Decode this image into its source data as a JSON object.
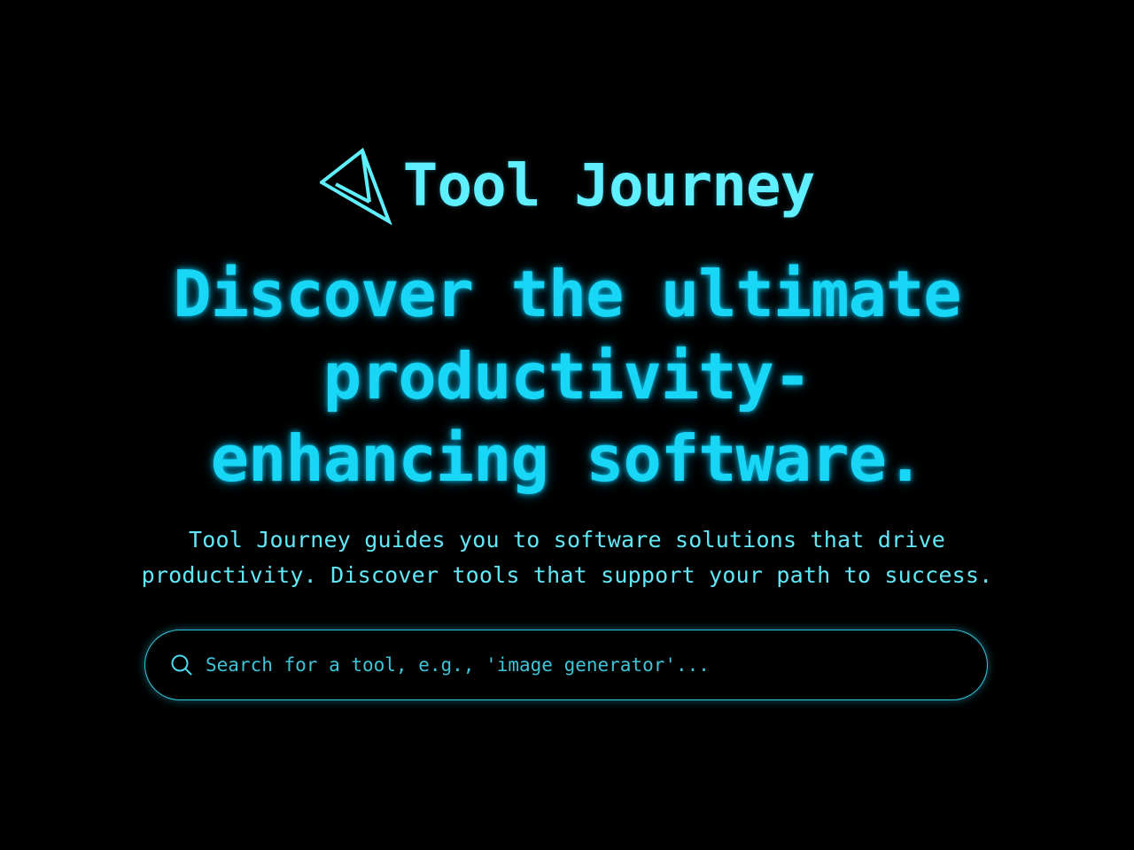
{
  "brand": {
    "name": "Tool Journey",
    "logo_icon": "paper-plane-arrow-logo",
    "color": "#5ff0ff"
  },
  "hero": {
    "headline_lines": [
      "Discover the ultimate",
      "productivity-",
      "enhancing software."
    ],
    "subtitle_lines": [
      "Tool Journey guides you to software solutions that drive",
      "productivity. Discover tools that support your path to success."
    ],
    "headline_color": "#18d6f5"
  },
  "search": {
    "placeholder": "Search for a tool, e.g., 'image generator'...",
    "value": "",
    "icon": "search-icon",
    "border_color": "#34c8dc"
  },
  "theme": {
    "background": "#000000",
    "accent": "#18d6f5"
  }
}
